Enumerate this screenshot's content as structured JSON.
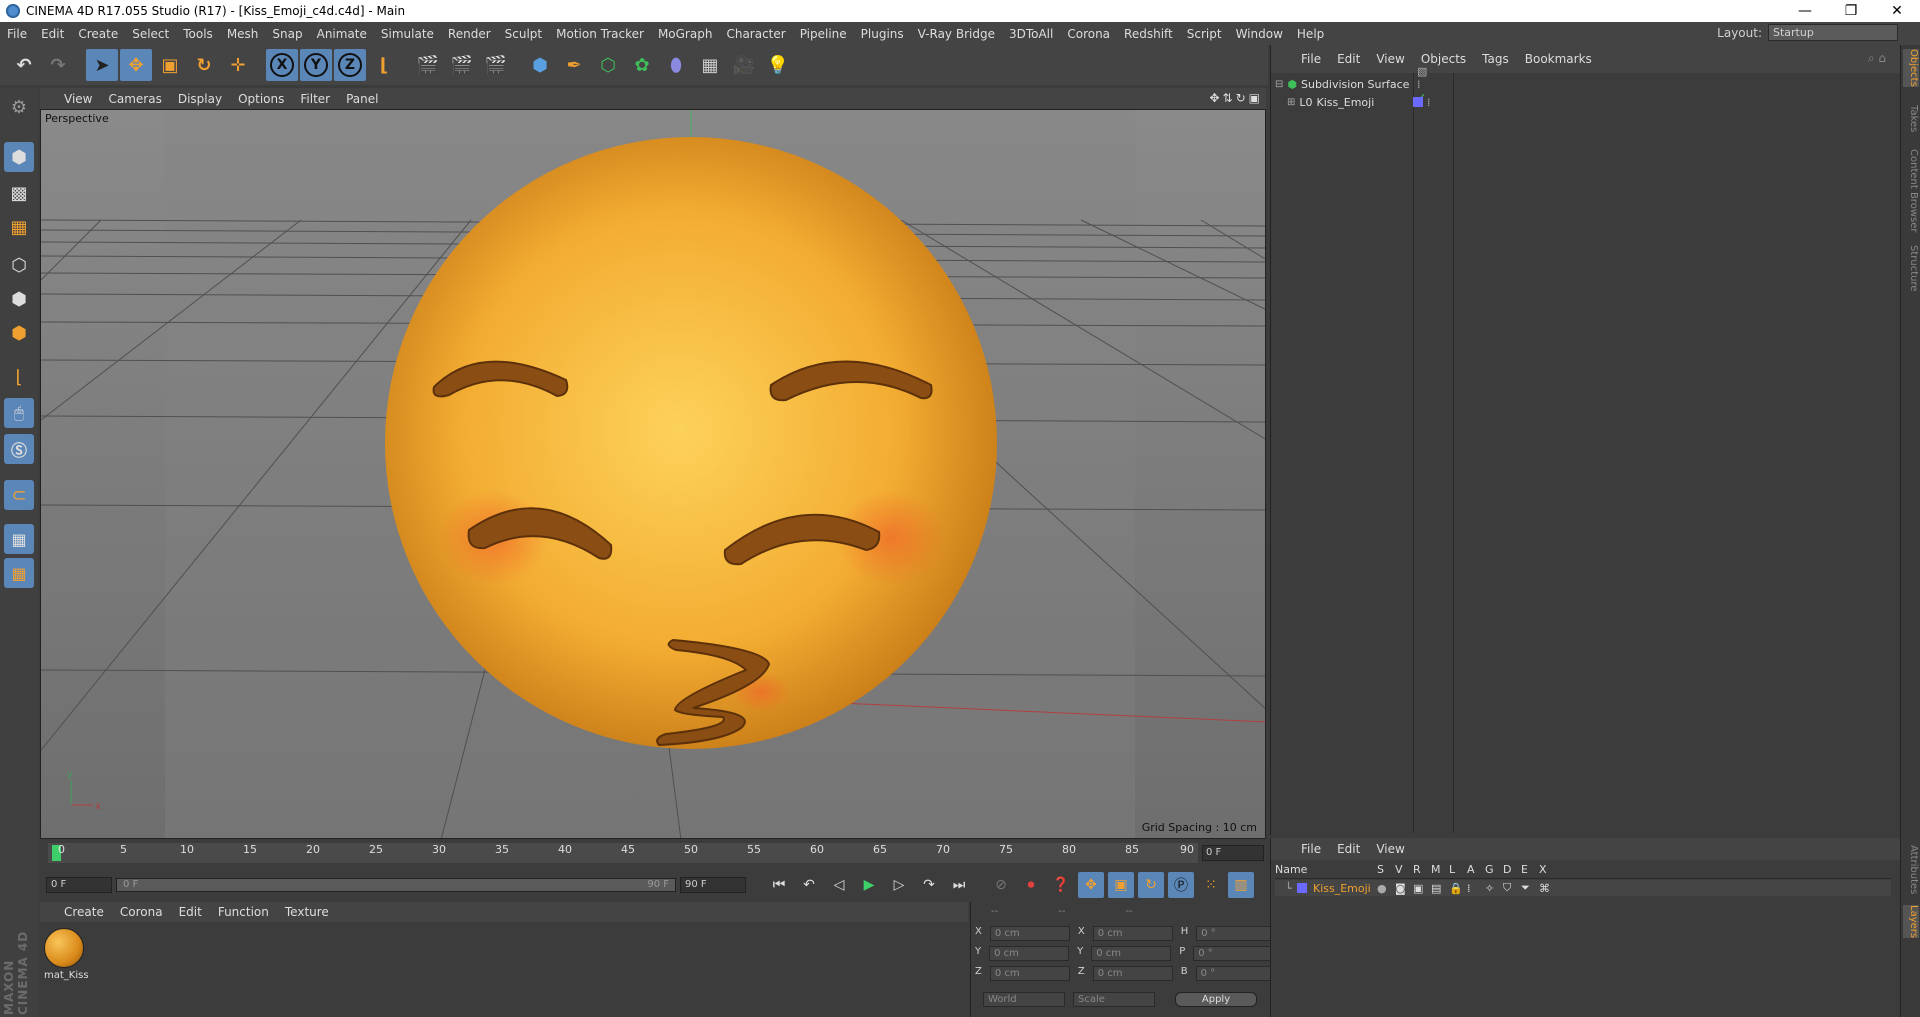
{
  "window": {
    "title": "CINEMA 4D R17.055 Studio (R17) - [Kiss_Emoji_c4d.c4d] - Main",
    "minimize": "—",
    "restore": "❐",
    "close": "✕"
  },
  "menubar": {
    "items": [
      "File",
      "Edit",
      "Create",
      "Select",
      "Tools",
      "Mesh",
      "Snap",
      "Animate",
      "Simulate",
      "Render",
      "Sculpt",
      "Motion Tracker",
      "MoGraph",
      "Character",
      "Pipeline",
      "Plugins",
      "V-Ray Bridge",
      "3DToAll",
      "Corona",
      "Redshift",
      "Script",
      "Window",
      "Help"
    ],
    "layout_label": "Layout:",
    "layout_value": "Startup"
  },
  "toolbar": {
    "x_label": "X",
    "y_label": "Y",
    "z_label": "Z"
  },
  "viewport": {
    "menu": [
      "View",
      "Cameras",
      "Display",
      "Options",
      "Filter",
      "Panel"
    ],
    "camera_label": "Perspective",
    "grid_spacing": "Grid Spacing : 10 cm",
    "axis_y": "y",
    "axis_x": "x"
  },
  "timeline": {
    "ticks": [
      "0",
      "5",
      "10",
      "15",
      "20",
      "25",
      "30",
      "35",
      "40",
      "45",
      "50",
      "55",
      "60",
      "65",
      "70",
      "75",
      "80",
      "85",
      "90"
    ],
    "current_frame": "0 F",
    "start_field": "0 F",
    "range_start": "0 F",
    "range_end": "90 F",
    "end_field": "90 F"
  },
  "material_manager": {
    "menu": [
      "Create",
      "Corona",
      "Edit",
      "Function",
      "Texture"
    ],
    "material_name": "mat_Kiss"
  },
  "coordinates": {
    "headers": [
      "--",
      "--",
      "--"
    ],
    "rows": [
      {
        "a": "X",
        "av": "0 cm",
        "b": "X",
        "bv": "0 cm",
        "c": "H",
        "cv": "0 °"
      },
      {
        "a": "Y",
        "av": "0 cm",
        "b": "Y",
        "bv": "0 cm",
        "c": "P",
        "cv": "0 °"
      },
      {
        "a": "Z",
        "av": "0 cm",
        "b": "Z",
        "bv": "0 cm",
        "c": "B",
        "cv": "0 °"
      }
    ],
    "world": "World",
    "scale": "Scale",
    "apply": "Apply"
  },
  "object_manager": {
    "menu": [
      "File",
      "Edit",
      "View",
      "Objects",
      "Tags",
      "Bookmarks"
    ],
    "objects": [
      {
        "name": "Subdivision Surface"
      },
      {
        "name": "Kiss_Emoji"
      }
    ]
  },
  "layer_manager": {
    "menu": [
      "File",
      "Edit",
      "View"
    ],
    "columns": [
      "Name",
      "S",
      "V",
      "R",
      "M",
      "L",
      "A",
      "G",
      "D",
      "E",
      "X"
    ],
    "layer_name": "Kiss_Emoji"
  },
  "right_tabs": [
    "Objects",
    "Takes",
    "Content Browser",
    "Structure",
    "Attributes",
    "Layers"
  ],
  "brand": "MAXON CINEMA 4D",
  "colors": {
    "accent": "#5b86b8",
    "emoji": "#f5b335",
    "feature": "#7a4612",
    "layer": "#f0a030"
  }
}
